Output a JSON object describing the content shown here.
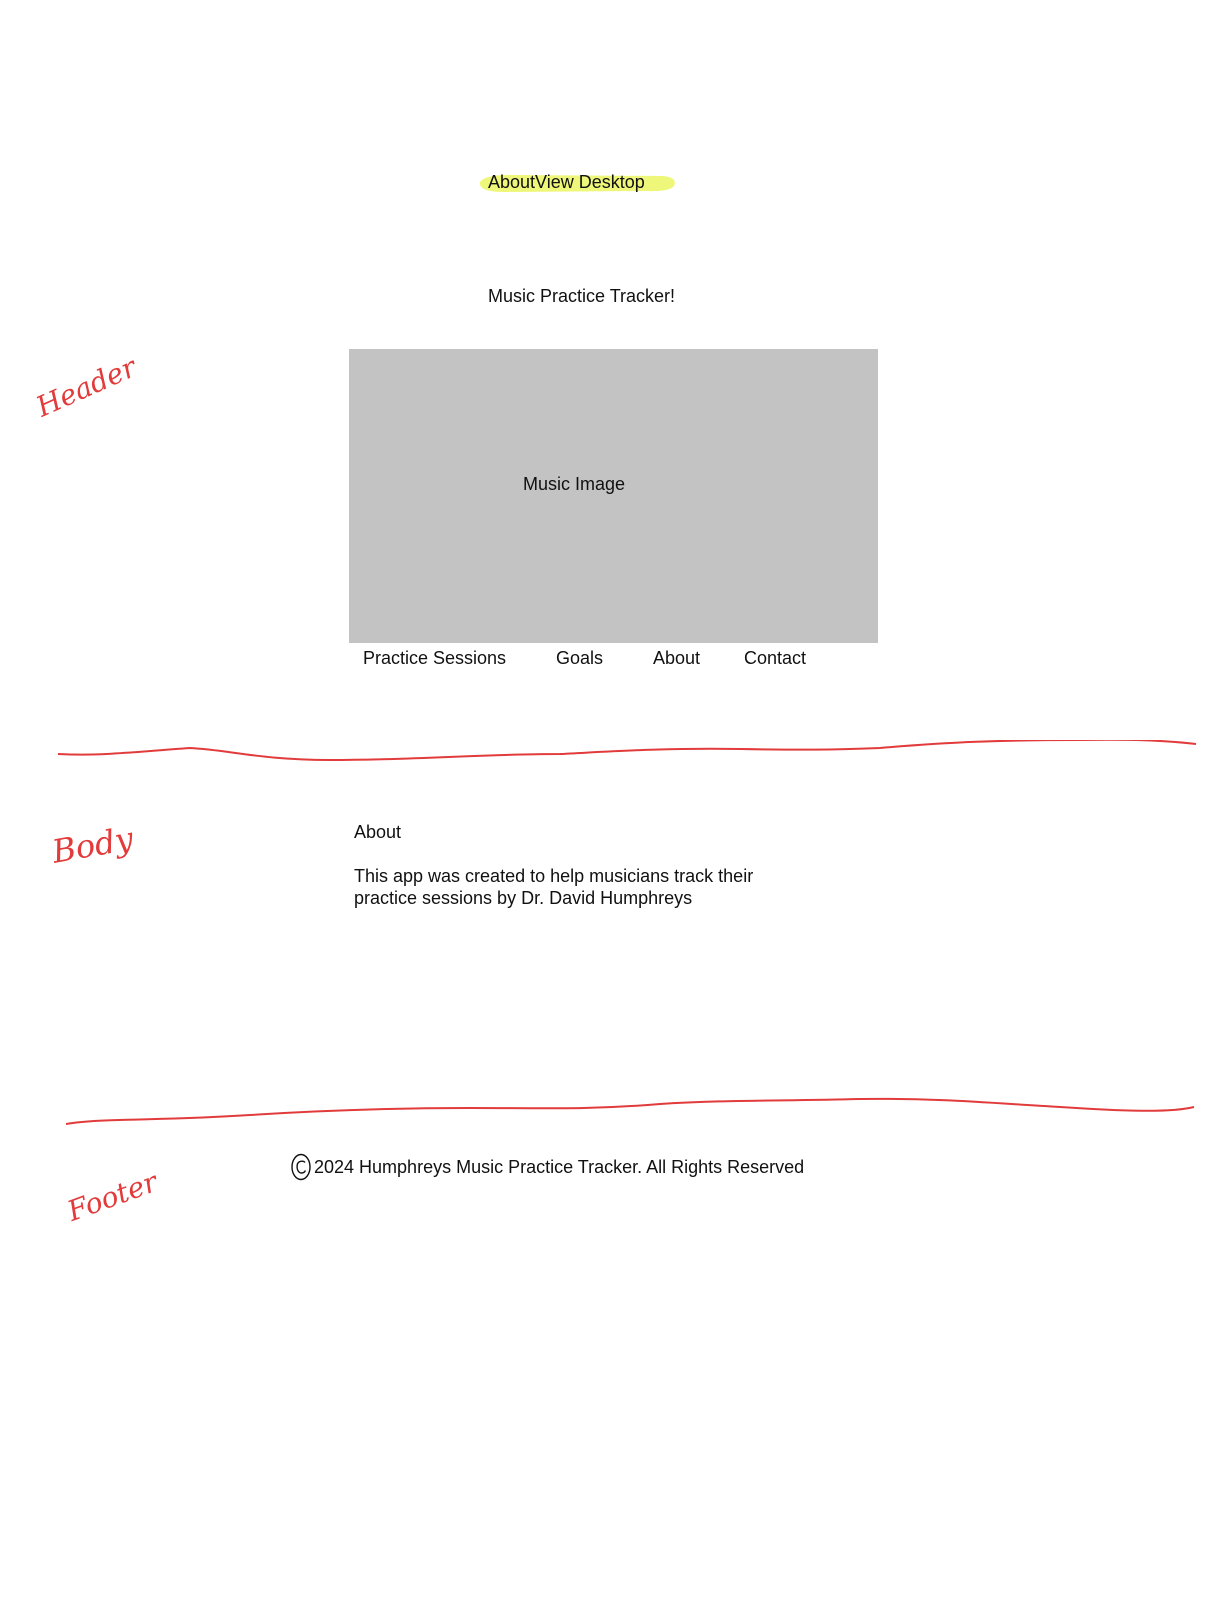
{
  "wireframe": {
    "title": "AboutView Desktop",
    "highlight_color": "#eef77a"
  },
  "header": {
    "site_title": "Music Practice Tracker!",
    "hero_image_label": "Music Image",
    "nav": [
      "Practice Sessions",
      "Goals",
      "About",
      "Contact"
    ]
  },
  "body": {
    "heading": "About",
    "text": "This app was created to help musicians track their practice sessions by Dr. David Humphreys"
  },
  "footer": {
    "copyright_icon": "copyright-icon",
    "text": "2024 Humphreys Music Practice Tracker. All Rights Reserved"
  },
  "annotations": {
    "color": "#e23b3b",
    "header_label": "Header",
    "body_label": "Body",
    "footer_label": "Footer"
  }
}
